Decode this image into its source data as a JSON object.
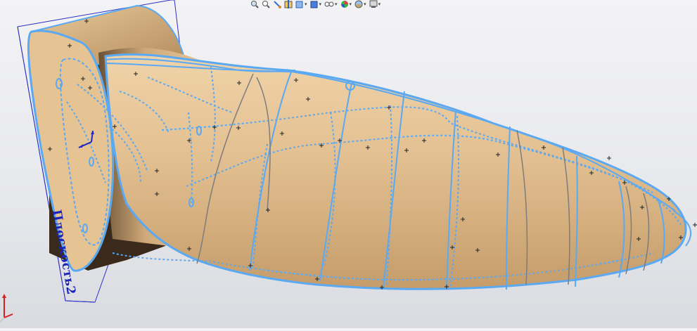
{
  "window": {
    "title": ""
  },
  "toolbar": {
    "items": [
      {
        "name": "zoom-to-fit-icon"
      },
      {
        "name": "zoom-to-area-icon"
      },
      {
        "name": "previous-view-icon"
      },
      {
        "name": "section-view-icon"
      },
      {
        "name": "view-orientation-icon",
        "dropdown": true
      },
      {
        "name": "display-style-icon",
        "dropdown": true
      },
      {
        "name": "hide-show-items-icon",
        "dropdown": true
      },
      {
        "name": "edit-appearance-icon",
        "dropdown": true
      },
      {
        "name": "apply-scene-icon",
        "dropdown": true
      },
      {
        "name": "view-settings-icon",
        "dropdown": true
      }
    ]
  },
  "model": {
    "plane_label": "Плоскость2",
    "surface_color": "#dfbc8f",
    "edge_color": "#5aa9f2",
    "plane_color": "#2a2fc4",
    "sketch_curve_color": "#7d7d7d"
  },
  "triad": {
    "x_color": "#d42020",
    "y_color": "#d42020",
    "z_color": "#c9c9c9"
  }
}
